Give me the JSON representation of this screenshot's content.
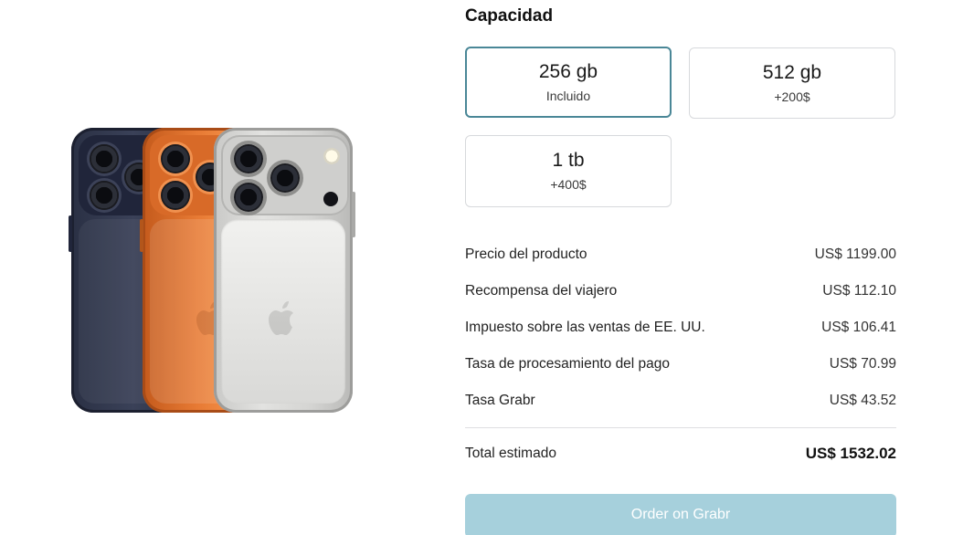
{
  "capacity": {
    "title": "Capacidad",
    "options": [
      {
        "size": "256 gb",
        "note": "Incluido",
        "selected": true
      },
      {
        "size": "512 gb",
        "note": "+200$",
        "selected": false
      },
      {
        "size": "1 tb",
        "note": "+400$",
        "selected": false
      }
    ]
  },
  "costs": [
    {
      "label": "Precio del producto",
      "amount": "US$ 1199.00"
    },
    {
      "label": "Recompensa del viajero",
      "amount": "US$ 112.10"
    },
    {
      "label": "Impuesto sobre las ventas de EE. UU.",
      "amount": "US$ 106.41"
    },
    {
      "label": "Tasa de procesamiento del pago",
      "amount": "US$ 70.99"
    },
    {
      "label": "Tasa Grabr",
      "amount": "US$ 43.52"
    }
  ],
  "total": {
    "label": "Total estimado",
    "amount": "US$ 1532.02"
  },
  "order_button": {
    "label": "Order on Grabr",
    "color": "#a6d0dc"
  },
  "colors": {
    "selected_border": "#4a8797",
    "card_border": "#d7d9dc"
  },
  "product_image": {
    "icon": "phone-trio-image",
    "finishes": [
      "navy",
      "orange",
      "silver"
    ]
  }
}
